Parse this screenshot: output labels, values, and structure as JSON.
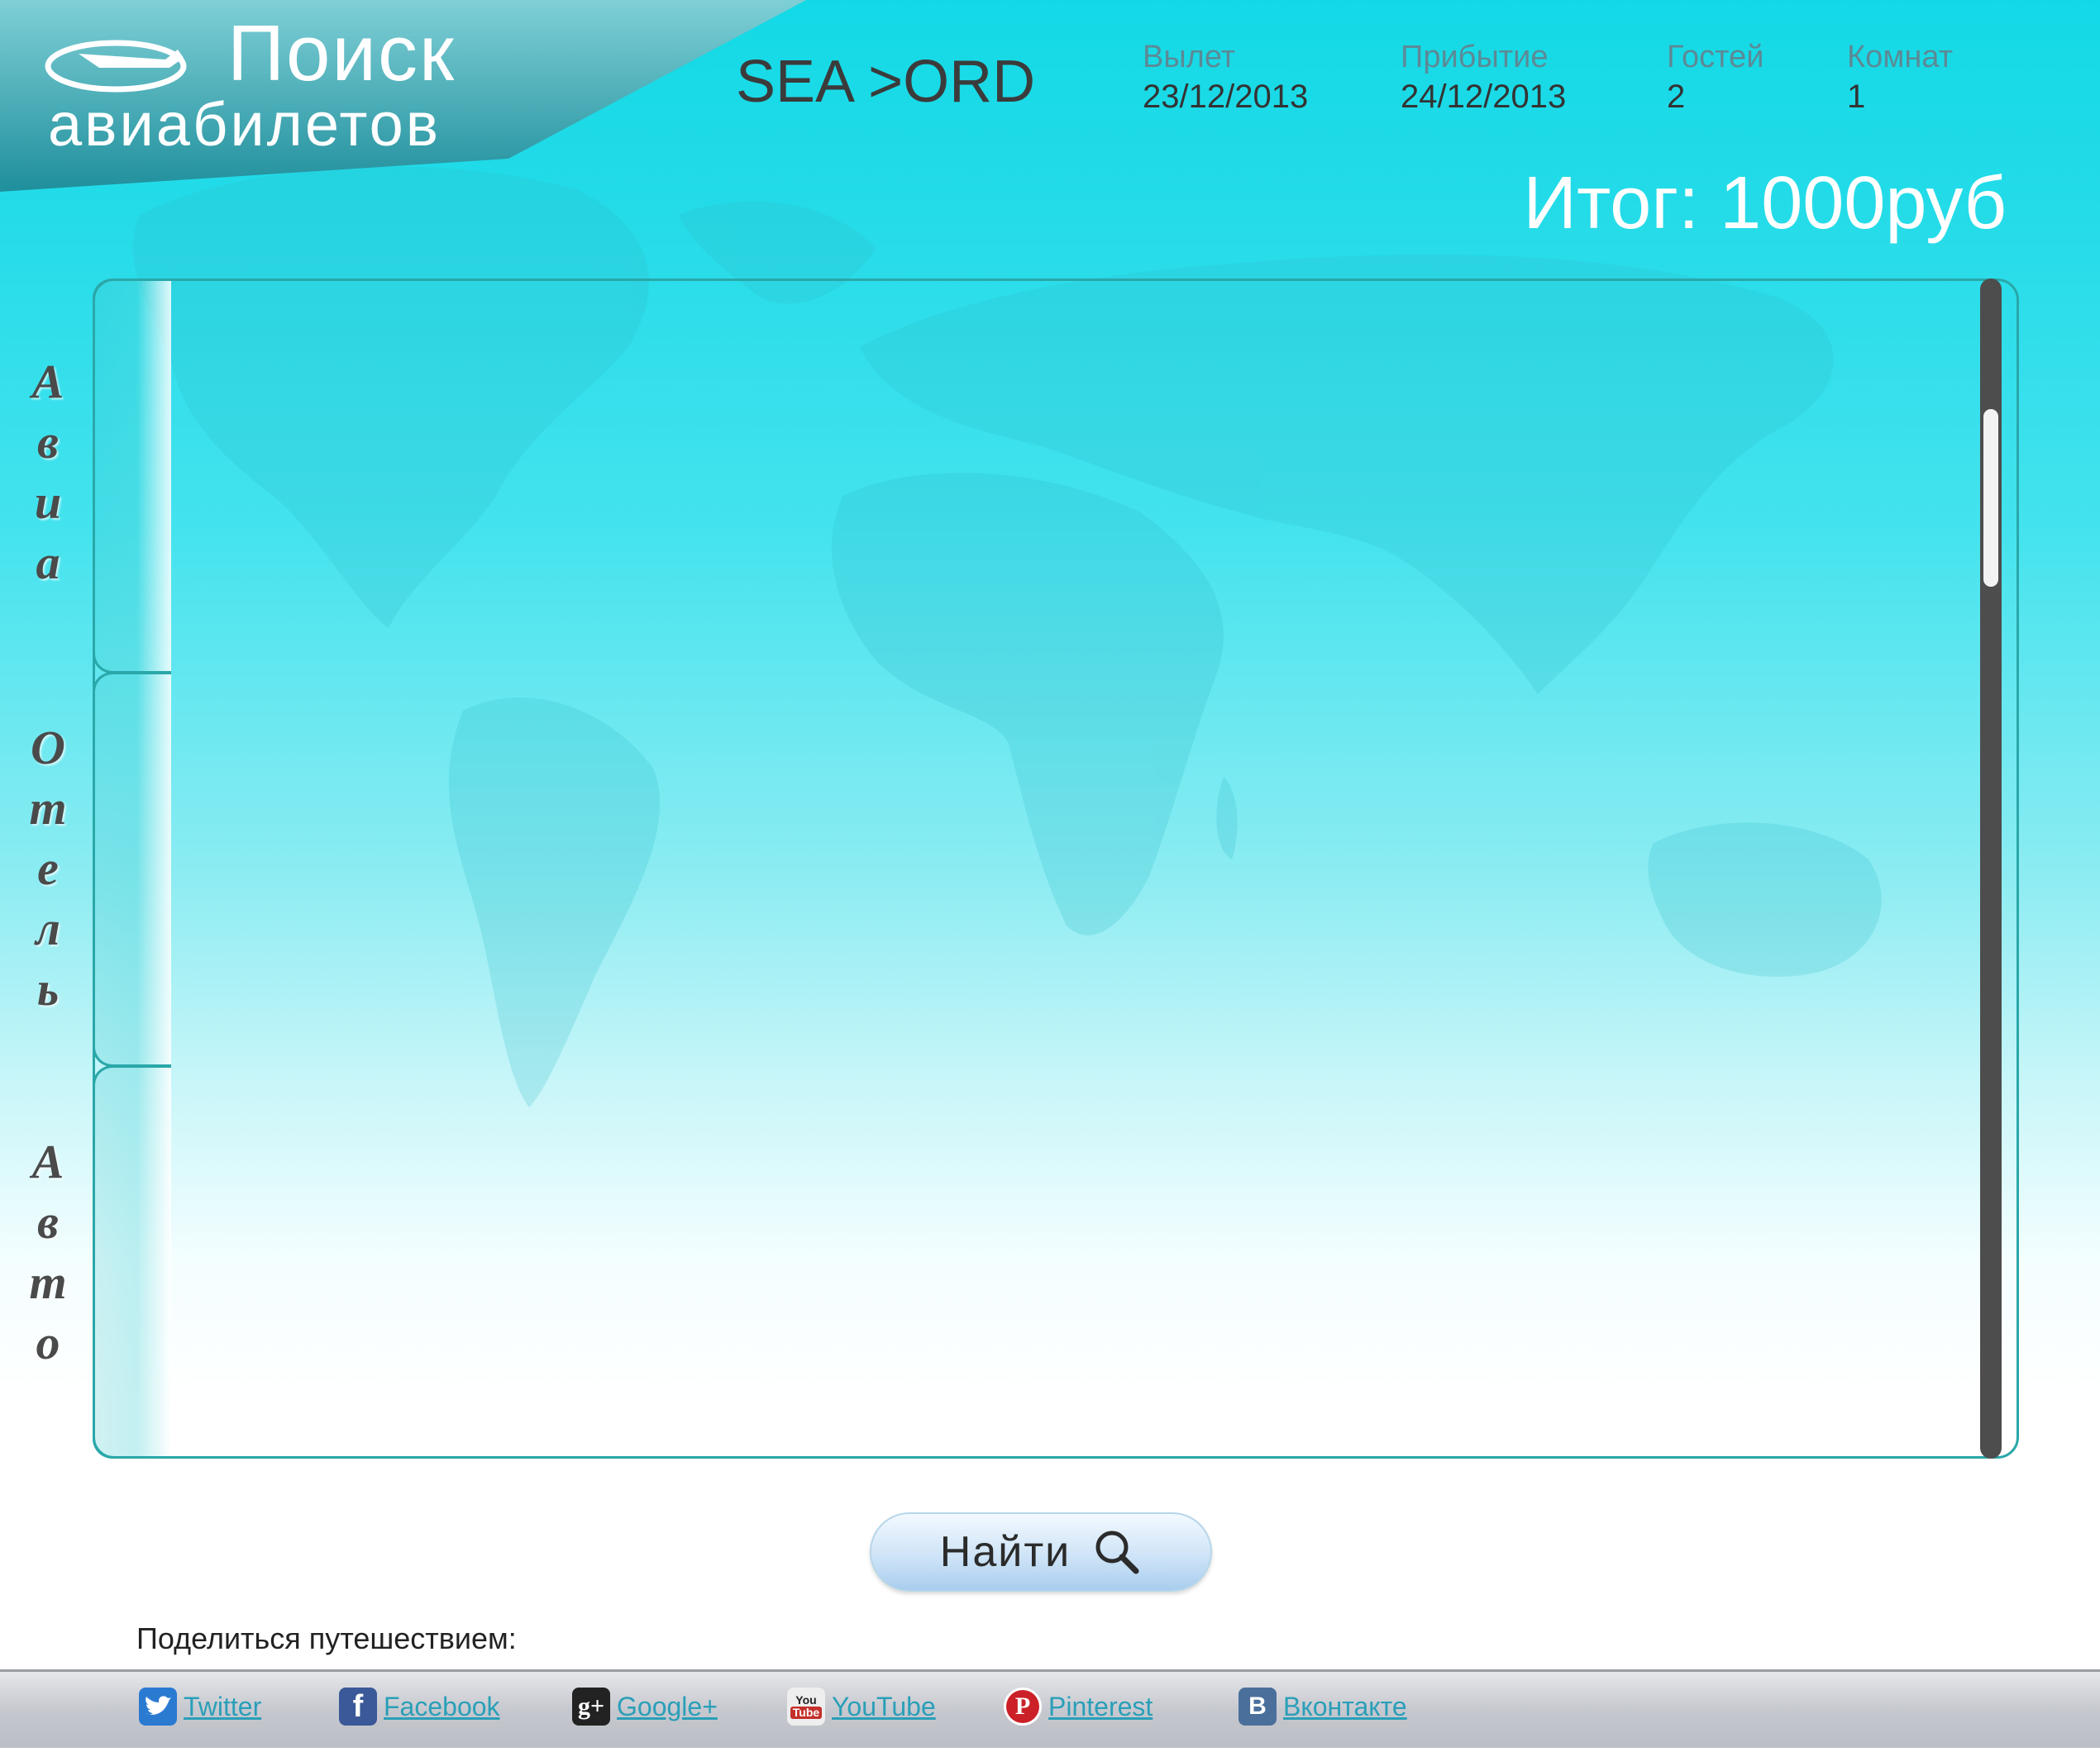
{
  "header": {
    "logo_line1": "Поиск",
    "logo_line2": "авиабилетов",
    "route": "SEA >ORD",
    "columns": [
      {
        "label": "Вылет",
        "value": "23/12/2013"
      },
      {
        "label": "Прибытие",
        "value": "24/12/2013"
      },
      {
        "label": "Гостей",
        "value": "2"
      },
      {
        "label": "Комнат",
        "value": "1"
      }
    ],
    "total": "Итог: 1000руб"
  },
  "tabs": [
    {
      "label": "Авиа",
      "letters": [
        "А",
        "в",
        "и",
        "а"
      ]
    },
    {
      "label": "Отель",
      "letters": [
        "О",
        "т",
        "е",
        "л",
        "ь"
      ]
    },
    {
      "label": "Авто",
      "letters": [
        "А",
        "в",
        "т",
        "о"
      ]
    }
  ],
  "search_button": {
    "label": "Найти"
  },
  "share": {
    "title": "Поделиться путешествием:"
  },
  "social": [
    {
      "name": "Twitter",
      "icon": "twitter-icon",
      "color": "#2a7ad2"
    },
    {
      "name": "Facebook",
      "icon": "facebook-icon",
      "color": "#3b5998"
    },
    {
      "name": "Google+",
      "icon": "google-plus-icon",
      "color": "#222222"
    },
    {
      "name": "YouTube",
      "icon": "youtube-icon",
      "color": "#c4302b"
    },
    {
      "name": "Pinterest",
      "icon": "pinterest-icon",
      "color": "#cb2027"
    },
    {
      "name": "Вконтакте",
      "icon": "vk-icon",
      "color": "#4a6f9b"
    }
  ]
}
